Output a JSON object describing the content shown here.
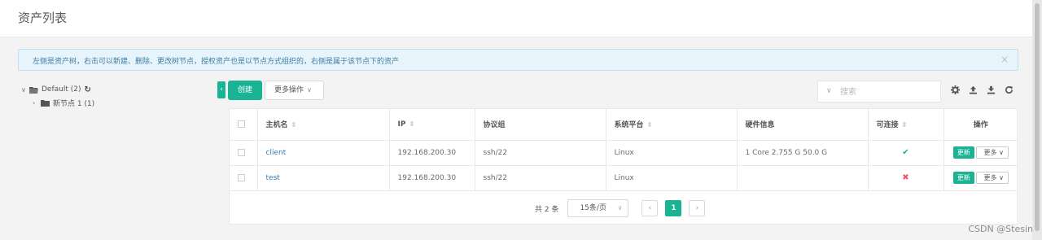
{
  "page": {
    "title": "资产列表"
  },
  "alert": {
    "text": "左侧是资产树，右击可以新建、删除、更改树节点，授权资产也是以节点方式组织的，右侧是属于该节点下的资产",
    "close_glyph": "×"
  },
  "tree": {
    "root": {
      "caret": "∨",
      "label": "Default (2)",
      "refresh_glyph": "↻"
    },
    "children": [
      {
        "caret": "›",
        "label": "新节点 1 (1)"
      }
    ]
  },
  "toolbar": {
    "toggle_glyph": "‹",
    "create_label": "创建",
    "more_label": "更多操作",
    "search_placeholder": "搜索",
    "icons": [
      "gear-icon",
      "upload-icon",
      "download-icon",
      "refresh-icon"
    ]
  },
  "table": {
    "headers": [
      "主机名",
      "IP",
      "协议组",
      "系统平台",
      "硬件信息",
      "可连接",
      "操作"
    ],
    "sort_glyph": "⇳",
    "rows": [
      {
        "hostname": "client",
        "ip": "192.168.200.30",
        "protocol": "ssh/22",
        "platform": "Linux",
        "hardware": "1 Core 2.755 G 50.0 G",
        "connectable": "✔",
        "connectable_ok": true,
        "update_label": "更新",
        "more_label": "更多"
      },
      {
        "hostname": "test",
        "ip": "192.168.200.30",
        "protocol": "ssh/22",
        "platform": "Linux",
        "hardware": "",
        "connectable": "✖",
        "connectable_ok": false,
        "update_label": "更新",
        "more_label": "更多"
      }
    ]
  },
  "pagination": {
    "total_text": "共 2 条",
    "page_size": "15条/页",
    "prev_glyph": "‹",
    "current_page": "1",
    "next_glyph": "›"
  },
  "watermark": "CSDN @Stesin",
  "colors": {
    "accent": "#1ab394",
    "link": "#337ab7",
    "danger": "#ed5565",
    "alert_bg": "#e8f4fb"
  }
}
